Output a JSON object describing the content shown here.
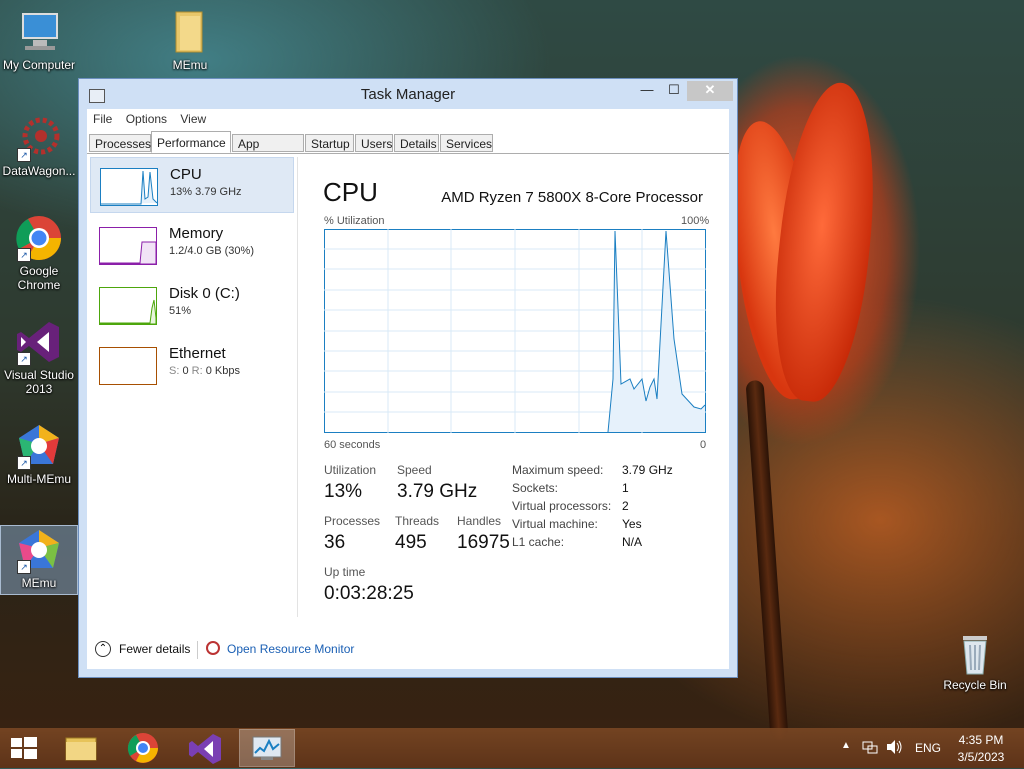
{
  "desktop": {
    "icons": [
      {
        "label": "My Computer"
      },
      {
        "label": "MEmu"
      },
      {
        "label": "DataWagon..."
      },
      {
        "label": "Google Chrome"
      },
      {
        "label": "Visual Studio 2013"
      },
      {
        "label": "Multi-MEmu"
      },
      {
        "label": "MEmu"
      },
      {
        "label": "Recycle Bin"
      }
    ]
  },
  "window": {
    "title": "Task Manager",
    "controls": {
      "minimize": "—",
      "maximize": "☐",
      "close": "✕"
    },
    "menu": [
      "File",
      "Options",
      "View"
    ],
    "tabs": [
      "Processes",
      "Performance",
      "App history",
      "Startup",
      "Users",
      "Details",
      "Services"
    ],
    "active_tab": "Performance",
    "resources": [
      {
        "name": "CPU",
        "detail": "13%  3.79 GHz",
        "color": "#1b7fc2"
      },
      {
        "name": "Memory",
        "detail": "1.2/4.0 GB (30%)",
        "color": "#8b1fa9"
      },
      {
        "name": "Disk 0 (C:)",
        "detail": "51%",
        "color": "#4da60c"
      },
      {
        "name": "Ethernet",
        "detail_s": "S:",
        "detail_s_val": "0",
        "detail_r": "R:",
        "detail_r_val": "0 Kbps",
        "color": "#a74f01"
      }
    ],
    "cpu_panel": {
      "title": "CPU",
      "model": "AMD Ryzen 7 5800X 8-Core Processor",
      "graph_label": "% Utilization",
      "graph_max": "100%",
      "graph_time": "60 seconds",
      "graph_min": "0",
      "utilization_label": "Utilization",
      "utilization": "13%",
      "speed_label": "Speed",
      "speed": "3.79 GHz",
      "processes_label": "Processes",
      "processes": "36",
      "threads_label": "Threads",
      "threads": "495",
      "handles_label": "Handles",
      "handles": "16975",
      "uptime_label": "Up time",
      "uptime": "0:03:28:25",
      "specs": [
        {
          "label": "Maximum speed:",
          "value": "3.79 GHz"
        },
        {
          "label": "Sockets:",
          "value": "1"
        },
        {
          "label": "Virtual processors:",
          "value": "2"
        },
        {
          "label": "Virtual machine:",
          "value": "Yes"
        },
        {
          "label": "L1 cache:",
          "value": "N/A"
        }
      ]
    },
    "footer": {
      "fewer_details": "Fewer details",
      "open_resource_monitor": "Open Resource Monitor"
    }
  },
  "taskbar": {
    "language": "ENG",
    "time": "4:35 PM",
    "date": "3/5/2023"
  }
}
